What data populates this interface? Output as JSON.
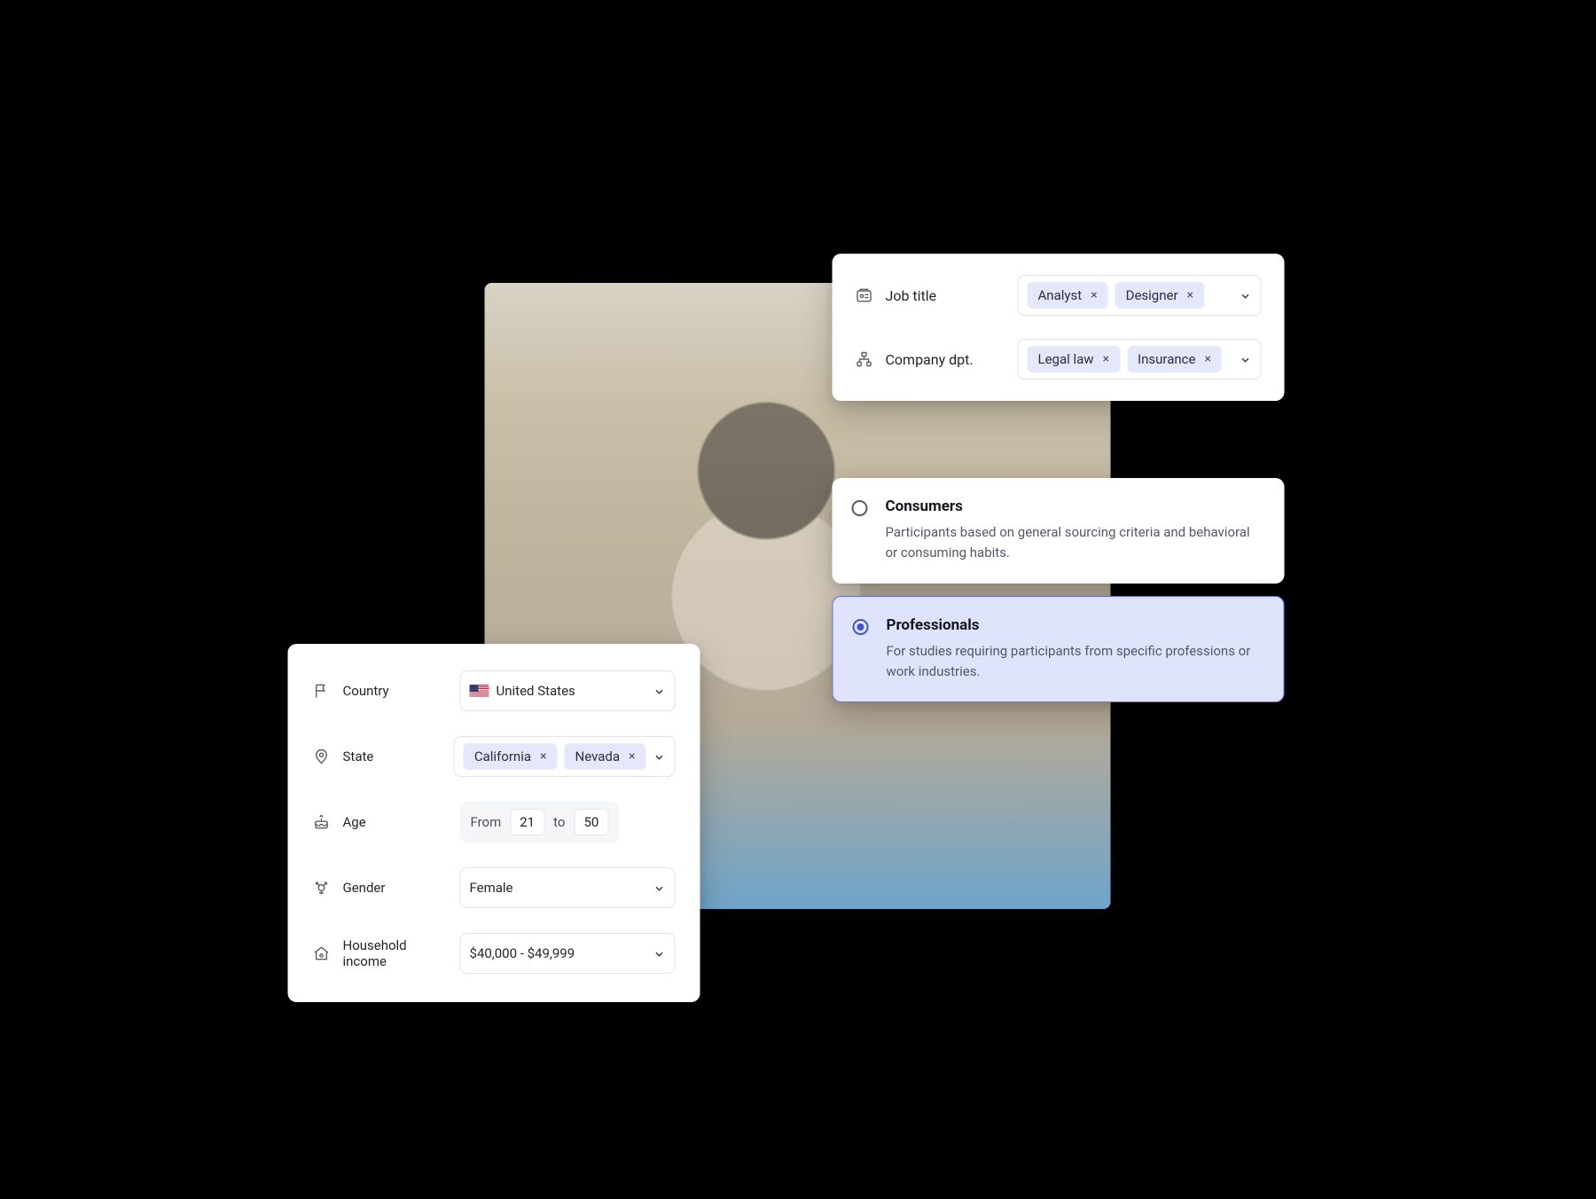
{
  "job_card": {
    "rows": [
      {
        "icon": "badge-icon",
        "label": "Job title",
        "chips": [
          "Analyst",
          "Designer"
        ]
      },
      {
        "icon": "org-icon",
        "label": "Company dpt.",
        "chips": [
          "Legal law",
          "Insurance"
        ]
      }
    ]
  },
  "type_options": [
    {
      "title": "Consumers",
      "desc": "Participants based on general sourcing criteria and behavioral or consuming habits.",
      "selected": false
    },
    {
      "title": "Professionals",
      "desc": "For studies requiring participants from specific professions or work industries.",
      "selected": true
    }
  ],
  "demo_card": {
    "country": {
      "label": "Country",
      "value": "United States"
    },
    "state": {
      "label": "State",
      "chips": [
        "California",
        "Nevada"
      ]
    },
    "age": {
      "label": "Age",
      "from_label": "From",
      "from": "21",
      "to_label": "to",
      "to": "50"
    },
    "gender": {
      "label": "Gender",
      "value": "Female"
    },
    "income": {
      "label": "Household income",
      "value": "$40,000 - $49,999"
    }
  }
}
